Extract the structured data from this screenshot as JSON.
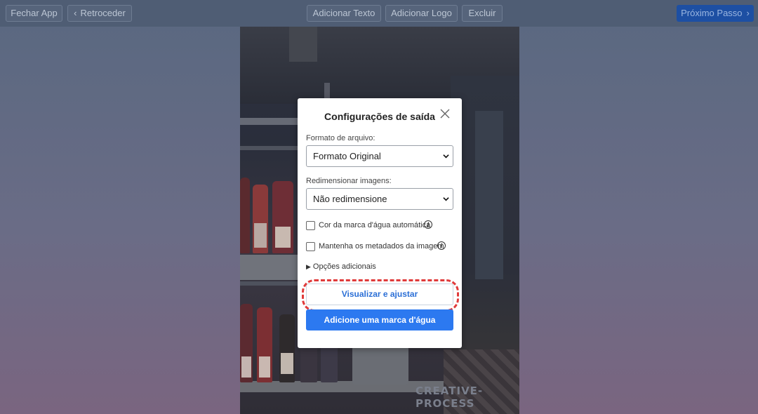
{
  "toolbar": {
    "close_app": "Fechar App",
    "back": "Retroceder",
    "add_text": "Adicionar Texto",
    "add_logo": "Adicionar Logo",
    "delete": "Excluir",
    "next_step": "Próximo Passo"
  },
  "photo": {
    "watermark_text": "CREATIVE-PROCESS"
  },
  "dialog": {
    "title": "Configurações de saída",
    "file_format_label": "Formato de arquivo:",
    "file_format_value": "Formato Original",
    "resize_label": "Redimensionar imagens:",
    "resize_value": "Não redimensione",
    "auto_color_label": "Cor da marca d'água automática",
    "auto_color_checked": false,
    "keep_metadata_label": "Mantenha os metadados da imagem",
    "keep_metadata_checked": false,
    "more_options_label": "Opções adicionais",
    "preview_button": "Visualizar e ajustar",
    "add_watermark_button": "Adicione uma marca d'água"
  },
  "colors": {
    "primary": "#2c79f0",
    "link": "#2b6fd6",
    "highlight": "#e03a3a",
    "toolbar_next": "#1d4fa3"
  }
}
